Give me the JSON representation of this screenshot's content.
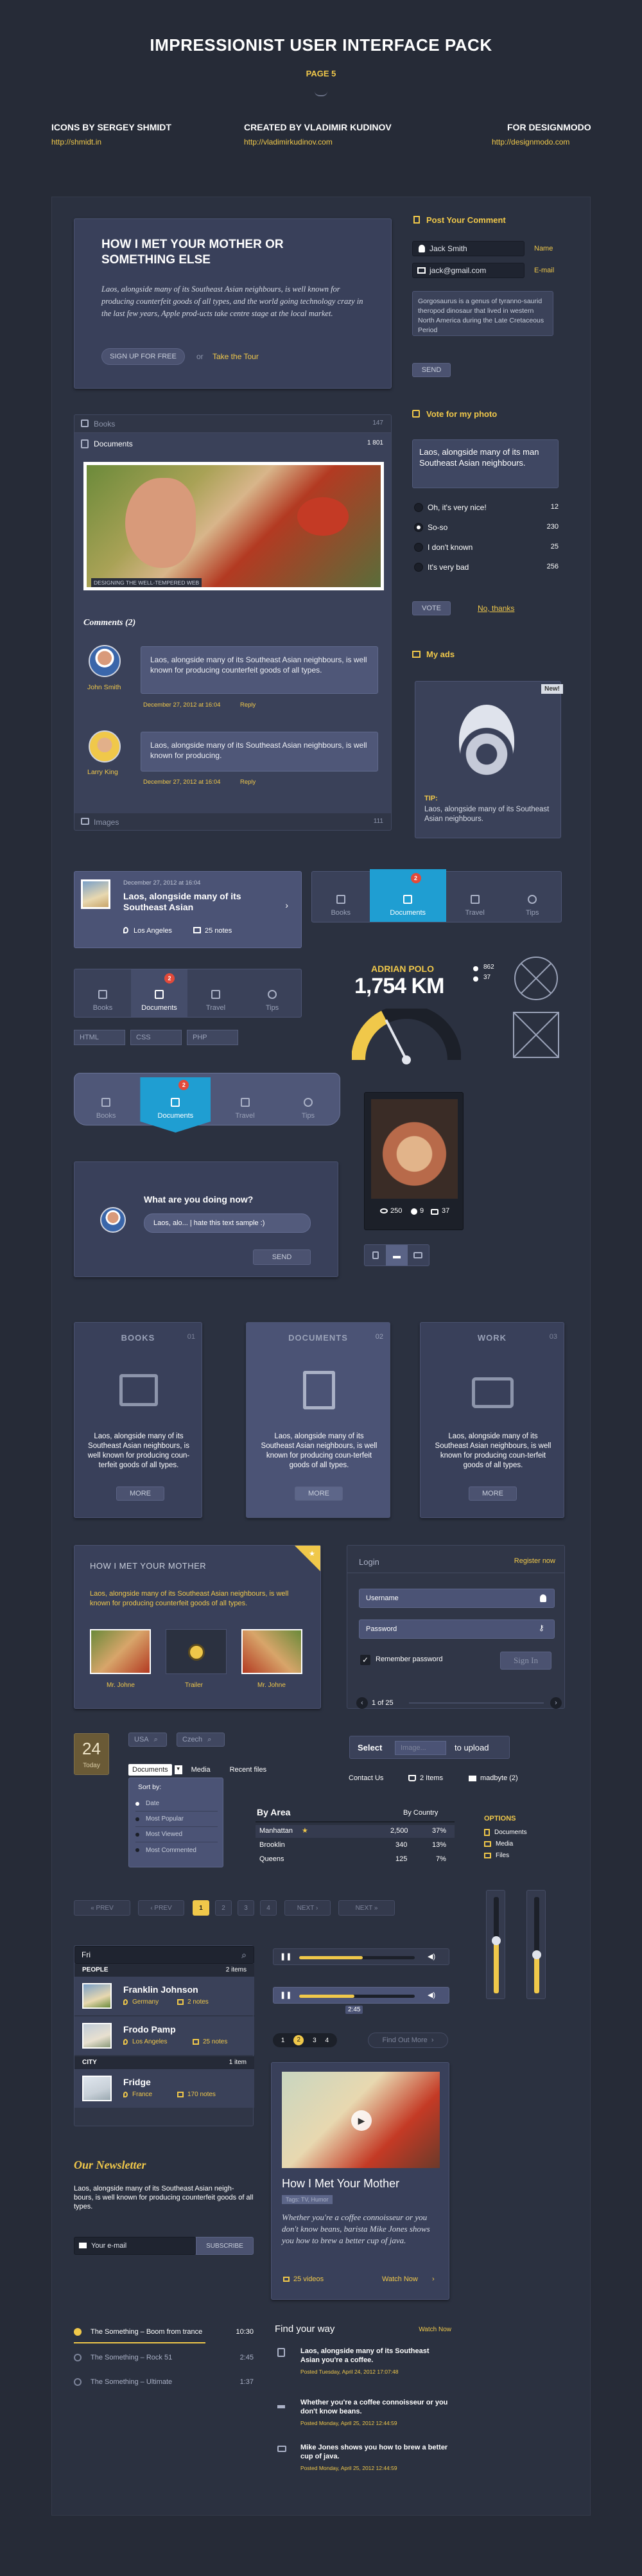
{
  "header": {
    "title": "IMPRESSIONIST USER INTERFACE PACK",
    "page": "PAGE 5",
    "credits": [
      {
        "label": "ICONS BY SERGEY SHMIDT",
        "url": "http://shmidt.in"
      },
      {
        "label": "CREATED BY VLADIMIR KUDINOV",
        "url": "http://vladimirkudinov.com"
      },
      {
        "label": "FOR DESIGNMODO",
        "url": "http://designmodo.com"
      }
    ]
  },
  "hero": {
    "title": "HOW I MET YOUR MOTHER OR SOMETHING ELSE",
    "text": "Laos, alongside many of its Southeast Asian neighbours, is well known for producing counterfeit goods of all types, and the world going technology crazy in the last few years, Apple prod-ucts take centre stage at the local market.",
    "signup": "SIGN UP FOR FREE",
    "or": "or",
    "tour": "Take the Tour"
  },
  "comment_form": {
    "title": "Post Your Comment",
    "name_value": "Jack Smith",
    "name_label": "Name",
    "email_value": "jack@gmail.com",
    "email_label": "E-mail",
    "message": "Gorgosaurus is a genus of tyranno-saurid theropod dinosaur that lived in western North America during the Late Cretaceous Period",
    "send": "SEND"
  },
  "documents_panel": {
    "books_label": "Books",
    "books_count": "147",
    "documents_label": "Documents",
    "documents_count": "1 801",
    "image_caption": "DESIGNING THE WELL-TEMPERED WEB",
    "comments_title": "Comments (2)",
    "comments": [
      {
        "author": "John Smith",
        "text": "Laos, alongside many of its Southeast Asian neighbours, is well known for producing counterfeit goods of all types.",
        "date": "December 27, 2012 at 16:04",
        "reply": "Reply"
      },
      {
        "author": "Larry King",
        "text": "Laos, alongside many of its Southeast Asian neighbours, is well known for producing.",
        "date": "December 27, 2012 at 16:04",
        "reply": "Reply"
      }
    ],
    "images_label": "Images",
    "images_count": "111"
  },
  "poll": {
    "title": "Vote for my photo",
    "question": "Laos, alongside many of its man Southeast Asian neighbours.",
    "options": [
      {
        "label": "Oh, it's very nice!",
        "count": "12",
        "selected": false
      },
      {
        "label": "So-so",
        "count": "230",
        "selected": true
      },
      {
        "label": "I don't known",
        "count": "25",
        "selected": false
      },
      {
        "label": "It's very bad",
        "count": "256",
        "selected": false
      }
    ],
    "vote": "VOTE",
    "no_thanks": "No, thanks"
  },
  "ads": {
    "title": "My ads",
    "tag": "New!",
    "tip_title": "TIP:",
    "tip_text": "Laos, alongside many of its Southeast Asian neighbours."
  },
  "notes_card": {
    "date": "December 27, 2012 at 16:04",
    "title": "Laos, alongside many of its Southeast Asian",
    "location": "Los Angeles",
    "notes": "25 notes"
  },
  "tabs": {
    "items": [
      "Books",
      "Documents",
      "Travel",
      "Tips"
    ],
    "badge": "2"
  },
  "breadcrumb": [
    "HTML",
    "CSS",
    "PHP"
  ],
  "speedometer": {
    "name": "ADRIAN POLO",
    "value": "1,754 KM",
    "stat1": "862",
    "stat2": "37",
    "level": 0.35
  },
  "photo_widget": {
    "views": "250",
    "likes": "9",
    "comments": "37"
  },
  "status": {
    "question": "What are you doing now?",
    "input": "Laos, alo... | hate this text sample :)",
    "send": "SEND"
  },
  "cards": [
    {
      "title": "BOOKS",
      "count": "01",
      "text": "Laos, alongside many of its Southeast Asian neighbours, is well known for producing coun-terfeit goods of all types.",
      "more": "MORE"
    },
    {
      "title": "DOCUMENTS",
      "count": "02",
      "text": "Laos, alongside many of its Southeast Asian neighbours, is well known for producing coun-terfeit goods of all types.",
      "more": "MORE"
    },
    {
      "title": "WORK",
      "count": "03",
      "text": "Laos, alongside many of its Southeast Asian neighbours, is well known for producing coun-terfeit goods of all types.",
      "more": "MORE"
    }
  ],
  "media_card": {
    "title": "HOW I MET YOUR MOTHER",
    "text": "Laos, alongside many of its Southeast Asian neighbours, is well known for producing counterfeit goods of all types.",
    "items": [
      "Mr. Johne",
      "Trailer",
      "Mr. Johne"
    ]
  },
  "login": {
    "title": "Login",
    "register": "Register now",
    "username": "Username",
    "password": "Password",
    "remember": "Remember password",
    "signin": "Sign In",
    "pager": "1 of 25"
  },
  "calendar": {
    "day": "24",
    "weekday": "Today"
  },
  "search_tags": [
    "USA",
    "Czech"
  ],
  "dropdown": {
    "tabs": [
      "Documents",
      "Media",
      "Recent files"
    ],
    "sort_label": "Sort by:",
    "options": [
      "Date",
      "Most Popular",
      "Most Viewed",
      "Most Commented"
    ]
  },
  "upload": {
    "select": "Select",
    "placeholder": "Image...",
    "to_upload": "to upload"
  },
  "contacts": {
    "contact_us": "Contact Us",
    "items": "2 Items",
    "user": "madbyte (2)"
  },
  "area_table": {
    "title": "By Area",
    "col": "By Country",
    "rows": [
      {
        "name": "Manhattan",
        "value": "2,500",
        "pct": "37%"
      },
      {
        "name": "Brooklin",
        "value": "340",
        "pct": "13%"
      },
      {
        "name": "Queens",
        "value": "125",
        "pct": "7%"
      }
    ]
  },
  "options": {
    "title": "OPTIONS",
    "items": [
      "Documents",
      "Media",
      "Files"
    ]
  },
  "pagination": {
    "first": "« PREV",
    "prev": "‹ PREV",
    "pages": [
      "1",
      "2",
      "3",
      "4"
    ],
    "next": "NEXT ›",
    "last": "NEXT »"
  },
  "people": {
    "search": "Fri",
    "people_label": "PEOPLE",
    "people_count": "2 items",
    "people": [
      {
        "name": "Franklin Johnson",
        "place": "Germany",
        "notes": "2 notes"
      },
      {
        "name": "Frodo Pamp",
        "place": "Los Angeles",
        "notes": "25 notes"
      }
    ],
    "city_label": "CITY",
    "city_count": "1 item",
    "cities": [
      {
        "name": "Fridge",
        "place": "France",
        "notes": "170 notes"
      }
    ]
  },
  "player": {
    "time": "2:45",
    "pages": [
      "1",
      "2",
      "3",
      "4"
    ],
    "load_more": "Find Out More",
    "progress1": 0.55,
    "progress2": 0.48
  },
  "volume": {
    "level1": 0.55,
    "level2": 0.4
  },
  "newsletter": {
    "title": "Our Newsletter",
    "text": "Laos, alongside many of its Southeast Asian neigh-bours, is well known for producing counterfeit goods of all types.",
    "placeholder": "Your e-mail",
    "subscribe": "SUBSCRIBE"
  },
  "video_card": {
    "title": "How I Met Your Mother",
    "subtitle": "Tags: TV, Humor",
    "text": "Whether you're a coffee connoisseur or you don't know beans, barista Mike Jones shows you how to brew a better cup of java.",
    "videos": "25 videos",
    "watch": "Watch Now"
  },
  "playlist": [
    {
      "title": "The Something – Boom from trance",
      "time": "10:30",
      "active": true
    },
    {
      "title": "The Something – Rock 51",
      "time": "2:45",
      "active": false
    },
    {
      "title": "The Something – Ultimate",
      "time": "1:37",
      "active": false
    }
  ],
  "find_way": {
    "title": "Find your way",
    "watch": "Watch Now",
    "items": [
      {
        "text": "Laos, alongside many of its Southeast Asian you're a coffee.",
        "date": "Posted Tuesday, April 24, 2012 17:07:48"
      },
      {
        "text": "Whether you're a coffee connoisseur or you don't know beans.",
        "date": "Posted Monday, April 25, 2012 12:44:59"
      },
      {
        "text": "Mike Jones shows you how to brew a better cup of java.",
        "date": "Posted Monday, April 25, 2012 12:44:59"
      }
    ]
  },
  "colors": {
    "accent": "#f0c84a",
    "active_tab": "#1f9ed2",
    "background": "#262b37"
  }
}
